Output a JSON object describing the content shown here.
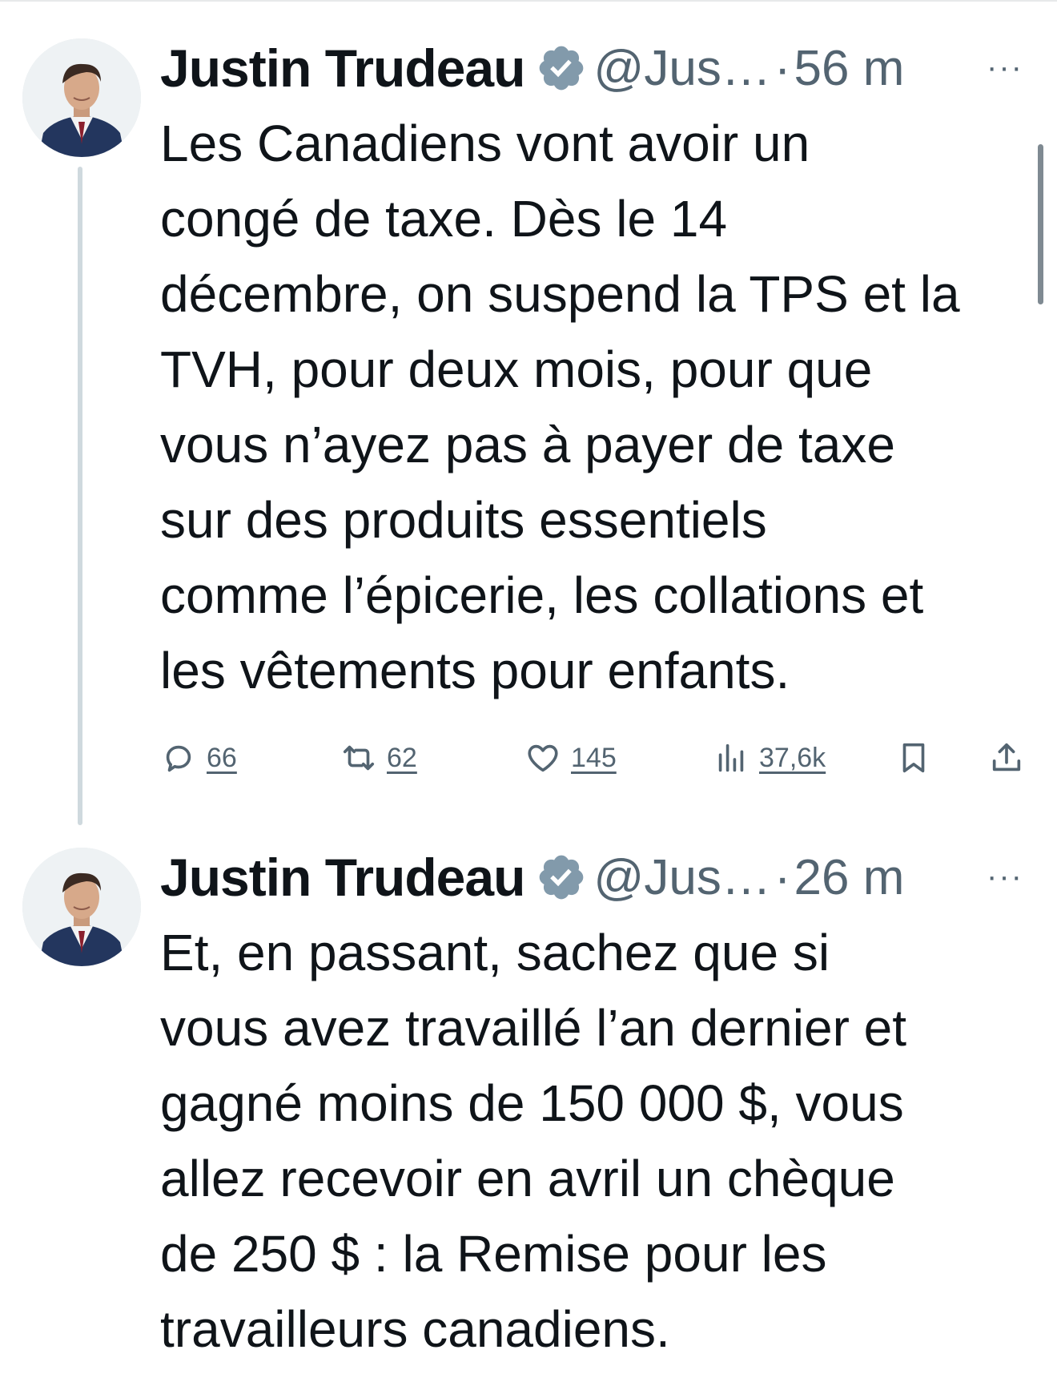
{
  "tweets": [
    {
      "author_name": "Justin Trudeau",
      "handle": "@Jus…",
      "separator": "·",
      "time": "56 m",
      "text": "Les Canadiens vont avoir un\ncongé de taxe. Dès le 14\ndécembre, on suspend la TPS et la\nTVH, pour deux mois, pour que\nvous n’ayez pas à payer de taxe\nsur des produits essentiels\ncomme l’épicerie, les collations et\nles vêtements pour enfants.",
      "replies": "66",
      "retweets": "62",
      "likes": "145",
      "views": "37,6k"
    },
    {
      "author_name": "Justin Trudeau",
      "handle": "@Jus…",
      "separator": "·",
      "time": "26 m",
      "text": "Et, en passant, sachez que si\nvous avez travaillé l’an dernier et\ngagné moins de 150 000 $, vous\nallez recevoir en avril un chèque\nde 250 $ : la Remise pour les\ntravailleurs canadiens."
    }
  ],
  "more_label": "···",
  "colors": {
    "text": "#0f1419",
    "secondary": "#536471",
    "verified_badge": "#829aab",
    "thread_line": "#cfd9de"
  },
  "icons": {
    "reply": "speech-bubble-icon",
    "retweet": "retweet-icon",
    "like": "heart-icon",
    "views": "bar-chart-icon",
    "bookmark": "bookmark-icon",
    "share": "share-upload-icon",
    "verified": "verified-badge-icon",
    "more": "more-dots-icon"
  }
}
